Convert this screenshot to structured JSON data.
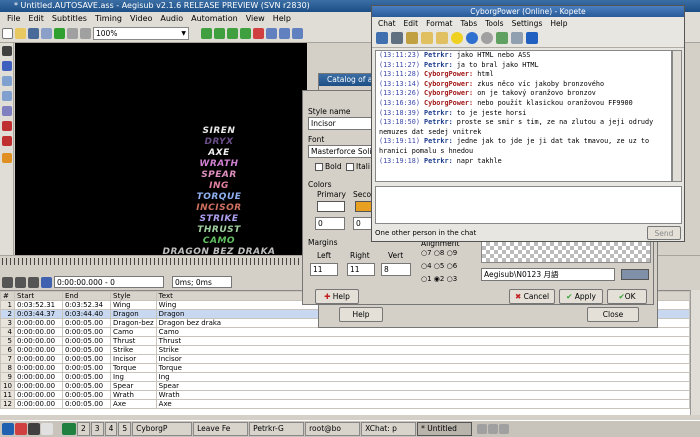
{
  "aegisub": {
    "title": "* Untitled.AUTOSAVE.ass - Aegisub v2.1.6 RELEASE PREVIEW (SVN r2830)",
    "menu": [
      "File",
      "Edit",
      "Subtitles",
      "Timing",
      "Video",
      "Audio",
      "Automation",
      "View",
      "Help"
    ],
    "zoom": "100%",
    "subtitle_lines": [
      {
        "text": "SIREN",
        "color": "#e8e8e8"
      },
      {
        "text": "DRYX",
        "color": "#6a4c88"
      },
      {
        "text": "AXE",
        "color": "#f0f0f0"
      },
      {
        "text": "WRATH",
        "color": "#d080d0"
      },
      {
        "text": "SPEAR",
        "color": "#e090c0"
      },
      {
        "text": "ING",
        "color": "#e080a0"
      },
      {
        "text": "TORQUE",
        "color": "#90b0f0"
      },
      {
        "text": "INCISOR",
        "color": "#d07060"
      },
      {
        "text": "STRIKE",
        "color": "#b0a0f0"
      },
      {
        "text": "THRUST",
        "color": "#a0d0a0"
      },
      {
        "text": "CAMO",
        "color": "#60c060"
      },
      {
        "text": "DRAGON BEZ DRAKA",
        "color": "#c0c0c0"
      }
    ],
    "time_field": "0:00:00.000 - 0",
    "ms_field": "0ms; 0ms",
    "grid": {
      "headers": [
        "#",
        "Start",
        "End",
        "Style",
        "Text"
      ],
      "rows": [
        [
          "1",
          "0:03:52.31",
          "0:03:52.34",
          "Wing",
          "Wing"
        ],
        [
          "2",
          "0:03:44.37",
          "0:03:44.40",
          "Dragon",
          "Dragon"
        ],
        [
          "3",
          "0:00:00.00",
          "0:00:05.00",
          "Dragon-bez",
          "Dragon bez draka"
        ],
        [
          "4",
          "0:00:00.00",
          "0:00:05.00",
          "Camo",
          "Camo"
        ],
        [
          "5",
          "0:00:00.00",
          "0:00:05.00",
          "Thrust",
          "Thrust"
        ],
        [
          "6",
          "0:00:00.00",
          "0:00:05.00",
          "Strike",
          "Strike"
        ],
        [
          "7",
          "0:00:00.00",
          "0:00:05.00",
          "Incisor",
          "Incisor"
        ],
        [
          "8",
          "0:00:00.00",
          "0:00:05.00",
          "Torque",
          "Torque"
        ],
        [
          "9",
          "0:00:00.00",
          "0:00:05.00",
          "Ing",
          "Ing"
        ],
        [
          "10",
          "0:00:00.00",
          "0:00:05.00",
          "Spear",
          "Spear"
        ],
        [
          "11",
          "0:00:00.00",
          "0:00:05.00",
          "Wrath",
          "Wrath"
        ],
        [
          "12",
          "0:00:00.00",
          "0:00:05.00",
          "Axe",
          "Axe"
        ]
      ]
    }
  },
  "style_editor": {
    "catalog_title": "Catalog of av",
    "style_name_label": "Style name",
    "style_name": "Incisor",
    "font_label": "Font",
    "font_name": "Masterforce Solid",
    "bold_label": "Bold",
    "italic_label": "Itali",
    "colors_label": "Colors",
    "primary_label": "Primary",
    "secondary_label": "Secon",
    "primary_alpha": "0",
    "secondary_alpha": "0",
    "margins_label": "Margins",
    "left_label": "Left",
    "right_label": "Right",
    "vert_label": "Vert",
    "left_val": "11",
    "right_val": "11",
    "vert_val": "8",
    "alignment_label": "Alignment",
    "align_row1": [
      "7",
      "8",
      "9"
    ],
    "align_row2": [
      "4",
      "5",
      "6"
    ],
    "align_row3": [
      "1",
      "2",
      "3"
    ],
    "preview_text": "Aegisub\\N0123 月語",
    "help_btn": "Help",
    "cancel_btn": "Cancel",
    "apply_btn": "Apply",
    "ok_btn": "OK",
    "help_btn2": "Help",
    "close_btn": "Close"
  },
  "kopete": {
    "title": "CyborgPower (Online) - Kopete",
    "menu": [
      "Chat",
      "Edit",
      "Format",
      "Tabs",
      "Tools",
      "Settings",
      "Help"
    ],
    "messages": [
      {
        "time": "(13:11:23)",
        "nick": "Petrkr:",
        "role": "n2",
        "text": "jako HTML nebo ASS"
      },
      {
        "time": "(13:11:27)",
        "nick": "Petrkr:",
        "role": "n2",
        "text": "ja to bral jako HTML"
      },
      {
        "time": "(13:11:28)",
        "nick": "CyborgPower:",
        "role": "n1",
        "text": "html"
      },
      {
        "time": "(13:13:14)",
        "nick": "CyborgPower:",
        "role": "n1",
        "text": "zkus něco víc jakoby bronzového"
      },
      {
        "time": "(13:13:26)",
        "nick": "CyborgPower:",
        "role": "n1",
        "text": "on je takový oranžovo bronzov"
      },
      {
        "time": "(13:16:36)",
        "nick": "CyborgPower:",
        "role": "n1",
        "text": "nebo použít klasickou oranžovou FF9900"
      },
      {
        "time": "(13:18:39)",
        "nick": "Petrkr:",
        "role": "n2",
        "text": "to je jeste horsi"
      },
      {
        "time": "(13:18:50)",
        "nick": "Petrkr:",
        "role": "n2",
        "text": "proste se smir s tim, ze na zlutou a jeji odrudy"
      },
      {
        "time": "",
        "nick": "",
        "role": "",
        "text": "nemuzes dat sedej vnitrek"
      },
      {
        "time": "(13:19:11)",
        "nick": "Petrkr:",
        "role": "n2",
        "text": "jedne jak to jde je ji dat tak tmavou, ze uz to"
      },
      {
        "time": "",
        "nick": "",
        "role": "",
        "text": "hranici pomalu s hnedou"
      },
      {
        "time": "(13:19:18)",
        "nick": "Petrkr:",
        "role": "n2",
        "text": "napr takhle"
      }
    ],
    "status": "One other person in the chat",
    "send": "Send"
  },
  "taskbar": {
    "desktops": [
      "2",
      "3",
      "4",
      "5"
    ],
    "tasks": [
      "CyborgP",
      "Leave Fe",
      "Petrkr-G",
      "root@bo",
      "XChat: p",
      "* Untitled"
    ]
  }
}
